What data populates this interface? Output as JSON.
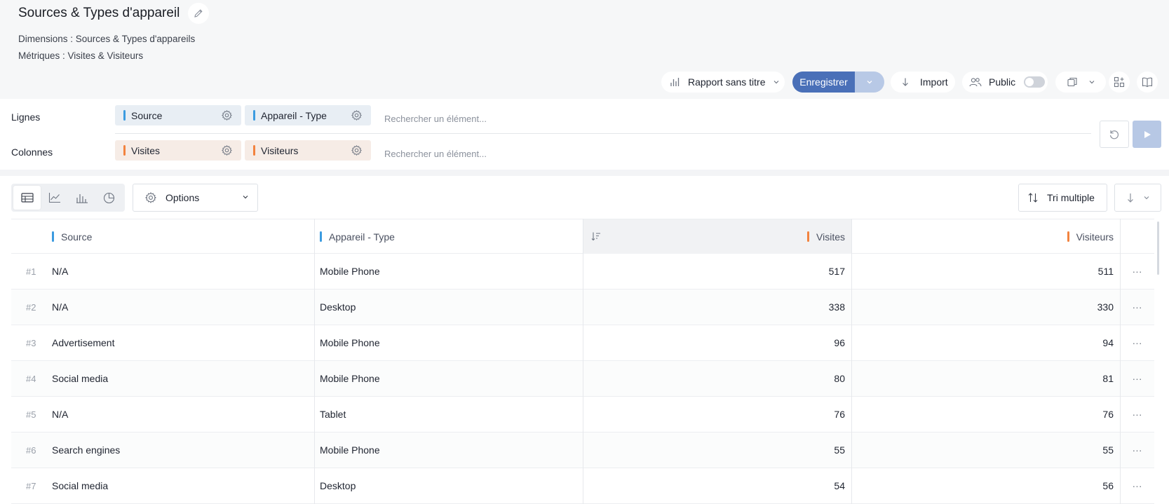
{
  "header": {
    "title": "Sources & Types d'appareil",
    "dimensions_text": "Dimensions : Sources & Types d'appareils",
    "metrics_text": "Métriques : Visites & Visiteurs",
    "report_select": "Rapport sans titre",
    "save_label": "Enregistrer",
    "import_label": "Import",
    "public_label": "Public",
    "public_enabled": false
  },
  "builder": {
    "rows_label": "Lignes",
    "columns_label": "Colonnes",
    "row_chips": [
      "Source",
      "Appareil - Type"
    ],
    "column_chips": [
      "Visites",
      "Visiteurs"
    ],
    "search_placeholder": "Rechercher un élément...",
    "colors": {
      "dimension": "#3b9be0",
      "metric": "#f2833f",
      "accent": "#4a70b8"
    }
  },
  "view": {
    "options_label": "Options",
    "multi_sort_label": "Tri multiple",
    "active_view": "table"
  },
  "table": {
    "columns": [
      "Source",
      "Appareil - Type",
      "Visites",
      "Visiteurs"
    ],
    "rows": [
      {
        "rank": "#1",
        "source": "N/A",
        "device": "Mobile Phone",
        "visits": "517",
        "visitors": "511"
      },
      {
        "rank": "#2",
        "source": "N/A",
        "device": "Desktop",
        "visits": "338",
        "visitors": "330"
      },
      {
        "rank": "#3",
        "source": "Advertisement",
        "device": "Mobile Phone",
        "visits": "96",
        "visitors": "94"
      },
      {
        "rank": "#4",
        "source": "Social media",
        "device": "Mobile Phone",
        "visits": "80",
        "visitors": "81"
      },
      {
        "rank": "#5",
        "source": "N/A",
        "device": "Tablet",
        "visits": "76",
        "visitors": "76"
      },
      {
        "rank": "#6",
        "source": "Search engines",
        "device": "Mobile Phone",
        "visits": "55",
        "visitors": "55"
      },
      {
        "rank": "#7",
        "source": "Social media",
        "device": "Desktop",
        "visits": "54",
        "visitors": "56"
      }
    ],
    "row_menu_glyph": "···"
  }
}
